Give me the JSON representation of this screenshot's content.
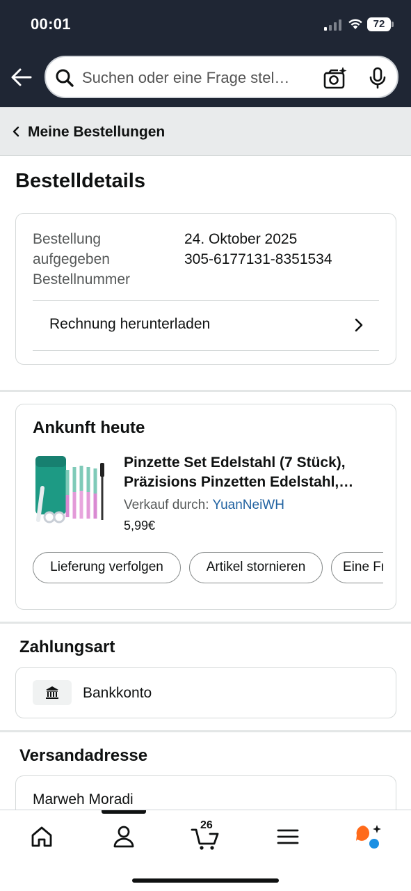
{
  "status_bar": {
    "time": "00:01",
    "battery": "72"
  },
  "search": {
    "placeholder": "Suchen oder eine Frage stel…"
  },
  "breadcrumb": {
    "label": "Meine Bestellungen"
  },
  "page": {
    "title": "Bestelldetails"
  },
  "order_info": {
    "label_line1": "Bestellung",
    "label_line2": "aufgegeben",
    "label_line3": "Bestellnummer",
    "date": "24. Oktober 2025",
    "order_number": "305-6177131-8351534",
    "invoice_label": "Rechnung herunterladen"
  },
  "shipment": {
    "status": "Ankunft heute",
    "product_title_line1": "Pinzette Set Edelstahl (7 Stück),",
    "product_title_line2": "Präzisions Pinzetten Edelstahl,…",
    "seller_prefix": "Verkauf durch: ",
    "seller_name": "YuanNeiWH",
    "price": "5,99€",
    "buttons": [
      "Lieferung verfolgen",
      "Artikel stornieren",
      "Eine Fr"
    ]
  },
  "payment": {
    "title": "Zahlungsart",
    "method": "Bankkonto"
  },
  "shipping": {
    "title": "Versandadresse",
    "name": "Marweh Moradi"
  },
  "bottom_nav": {
    "cart_count": "26"
  },
  "colors": {
    "header": "#1f2634",
    "link": "#2162a1",
    "rufus_orange": "#ff6a1a",
    "rufus_blue": "#1a8fe3"
  }
}
